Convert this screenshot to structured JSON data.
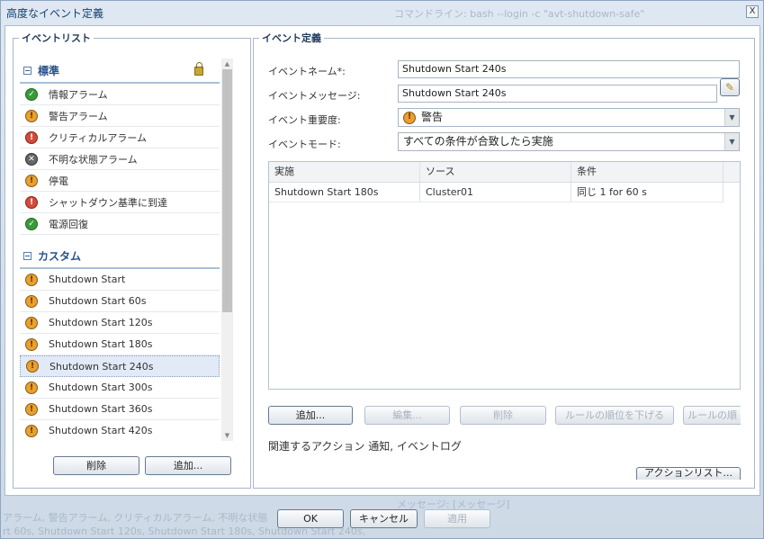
{
  "window": {
    "title": "高度なイベント定義",
    "close": "X"
  },
  "background_text": {
    "line1": "コマンドライン: bash --login -c \"avt-shutdown-safe\"",
    "line2": "メッセージ: [メッセージ]",
    "line3": "アラーム, 警告アラーム, クリティカルアラーム, 不明な状態",
    "line4": "rt 60s, Shutdown Start 120s, Shutdown Start 180s, Shutdown Start 240s,"
  },
  "event_list": {
    "legend": "イベントリスト",
    "groups": [
      {
        "title": "標準",
        "toggle": "−",
        "locked": true,
        "items": [
          {
            "label": "情報アラーム",
            "icon": "ok"
          },
          {
            "label": "警告アラーム",
            "icon": "warn"
          },
          {
            "label": "クリティカルアラーム",
            "icon": "crit"
          },
          {
            "label": "不明な状態アラーム",
            "icon": "unknown"
          },
          {
            "label": "停電",
            "icon": "warn"
          },
          {
            "label": "シャットダウン基準に到達",
            "icon": "crit"
          },
          {
            "label": "電源回復",
            "icon": "ok"
          }
        ]
      },
      {
        "title": "カスタム",
        "toggle": "−",
        "items": [
          {
            "label": "Shutdown Start",
            "icon": "warn"
          },
          {
            "label": "Shutdown Start 60s",
            "icon": "warn"
          },
          {
            "label": "Shutdown Start 120s",
            "icon": "warn"
          },
          {
            "label": "Shutdown Start 180s",
            "icon": "warn"
          },
          {
            "label": "Shutdown Start 240s",
            "icon": "warn",
            "selected": true
          },
          {
            "label": "Shutdown Start 300s",
            "icon": "warn"
          },
          {
            "label": "Shutdown Start 360s",
            "icon": "warn"
          },
          {
            "label": "Shutdown Start 420s",
            "icon": "warn"
          }
        ]
      }
    ],
    "delete_button": "削除",
    "add_button": "追加..."
  },
  "event_def": {
    "legend": "イベント定義",
    "name_label": "イベントネーム*:",
    "name_value": "Shutdown Start 240s",
    "message_label": "イベントメッセージ:",
    "message_value": "Shutdown Start 240s",
    "severity_label": "イベント重要度:",
    "severity_value": "警告",
    "mode_label": "イベントモード:",
    "mode_value": "すべての条件が合致したら実施",
    "table": {
      "columns": [
        "実施",
        "ソース",
        "条件"
      ],
      "rows": [
        [
          "Shutdown Start 180s",
          "Cluster01",
          "同じ 1 for 60 s"
        ]
      ]
    },
    "buttons": {
      "add": "追加...",
      "edit": "編集...",
      "delete": "削除",
      "lower": "ルールの順位を下げる",
      "raise": "ルールの順"
    },
    "associated_actions": "関連するアクション 通知, イベントログ",
    "action_list_button": "アクションリスト..."
  },
  "footer": {
    "ok": "OK",
    "cancel": "キャンセル",
    "apply": "適用"
  }
}
